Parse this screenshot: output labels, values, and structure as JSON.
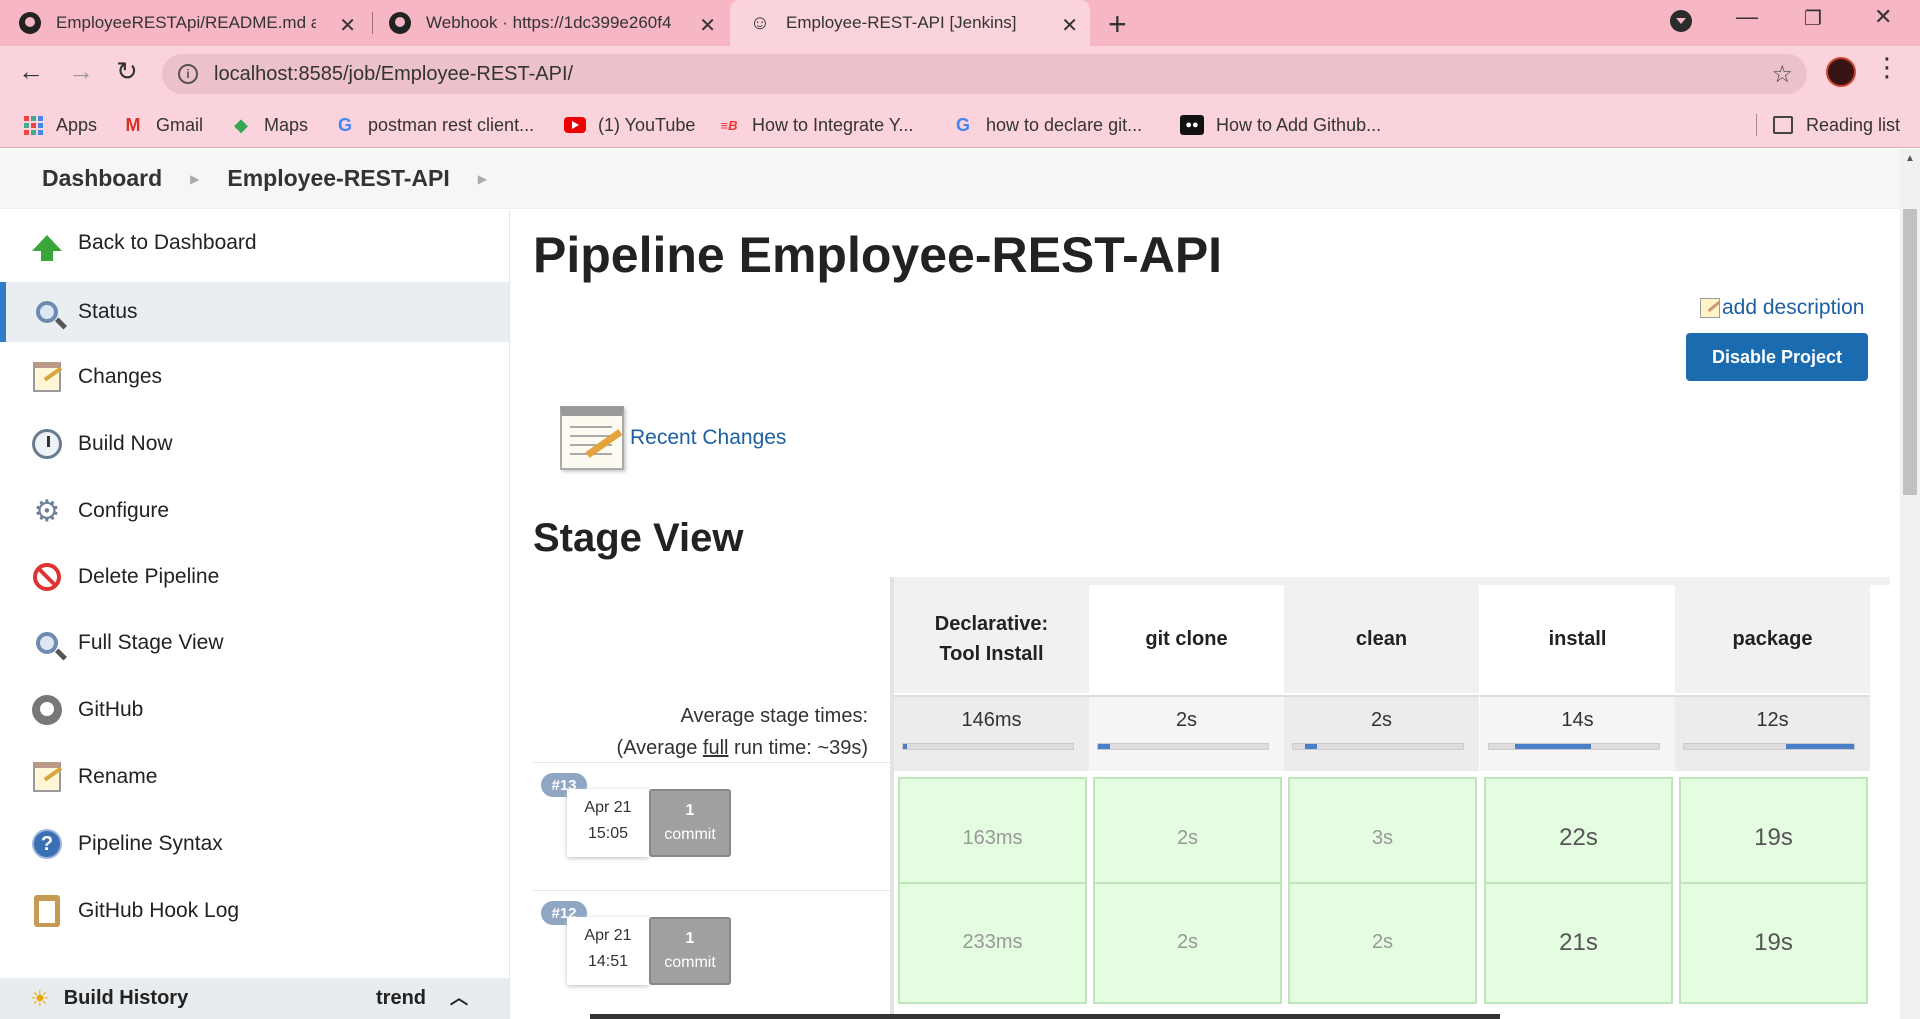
{
  "browser": {
    "tabs": [
      {
        "title": "EmployeeRESTApi/README.md at",
        "favicon": "github-icon"
      },
      {
        "title": "Webhook · https://1dc399e260f4",
        "favicon": "github-icon"
      },
      {
        "title": "Employee-REST-API [Jenkins]",
        "favicon": "jenkins-icon",
        "active": true
      }
    ],
    "close_glyph": "✕",
    "new_tab_glyph": "+",
    "url": "localhost:8585/job/Employee-REST-API/",
    "bookmarks": [
      {
        "label": "Apps",
        "icon": "apps-icon"
      },
      {
        "label": "Gmail",
        "icon": "gmail-icon"
      },
      {
        "label": "Maps",
        "icon": "maps-icon"
      },
      {
        "label": "postman rest client...",
        "icon": "google-icon"
      },
      {
        "label": "(1) YouTube",
        "icon": "youtube-icon"
      },
      {
        "label": "How to Integrate Y...",
        "icon": "bookmark-b-icon"
      },
      {
        "label": "how to declare git...",
        "icon": "google-icon"
      },
      {
        "label": "How to Add Github...",
        "icon": "medium-icon"
      }
    ],
    "reading_list": "Reading list"
  },
  "breadcrumbs": [
    "Dashboard",
    "Employee-REST-API"
  ],
  "sidebar": {
    "items": [
      {
        "label": "Back to Dashboard",
        "icon": "up-arrow-icon"
      },
      {
        "label": "Status",
        "icon": "search-icon",
        "active": true
      },
      {
        "label": "Changes",
        "icon": "notepad-icon"
      },
      {
        "label": "Build Now",
        "icon": "clock-icon"
      },
      {
        "label": "Configure",
        "icon": "gear-icon"
      },
      {
        "label": "Delete Pipeline",
        "icon": "ban-icon"
      },
      {
        "label": "Full Stage View",
        "icon": "search-icon"
      },
      {
        "label": "GitHub",
        "icon": "github-icon"
      },
      {
        "label": "Rename",
        "icon": "notepad-icon"
      },
      {
        "label": "Pipeline Syntax",
        "icon": "help-icon"
      },
      {
        "label": "GitHub Hook Log",
        "icon": "clipboard-icon"
      }
    ],
    "build_history": {
      "label": "Build History",
      "trend": "trend"
    }
  },
  "main": {
    "title": "Pipeline Employee-REST-API",
    "add_description": "add description",
    "disable_button": "Disable Project",
    "recent_changes": "Recent Changes",
    "stage_view_title": "Stage View",
    "avg_label_1": "Average stage times:",
    "avg_label_2_pre": "(Average ",
    "avg_label_2_link": "full",
    "avg_label_2_post": " run time: ~39s)"
  },
  "stages": [
    {
      "name_line1": "Declarative:",
      "name_line2": "Tool Install",
      "avg": "146ms",
      "avg_fill_fraction": [
        0.0,
        0.02
      ]
    },
    {
      "name_line1": "git clone",
      "name_line2": "",
      "avg": "2s",
      "avg_fill_fraction": [
        0.0,
        0.07
      ]
    },
    {
      "name_line1": "clean",
      "name_line2": "",
      "avg": "2s",
      "avg_fill_fraction": [
        0.07,
        0.14
      ]
    },
    {
      "name_line1": "install",
      "name_line2": "",
      "avg": "14s",
      "avg_fill_fraction": [
        0.15,
        0.6
      ]
    },
    {
      "name_line1": "package",
      "name_line2": "",
      "avg": "12s",
      "avg_fill_fraction": [
        0.6,
        1.0
      ]
    }
  ],
  "builds": [
    {
      "number": "#13",
      "date": "Apr 21",
      "time": "15:05",
      "commits_n": "1",
      "commits_label": "commit",
      "times": [
        "163ms",
        "2s",
        "3s",
        "22s",
        "19s"
      ]
    },
    {
      "number": "#12",
      "date": "Apr 21",
      "time": "14:51",
      "commits_n": "1",
      "commits_label": "commit",
      "times": [
        "233ms",
        "2s",
        "2s",
        "21s",
        "19s"
      ]
    }
  ]
}
